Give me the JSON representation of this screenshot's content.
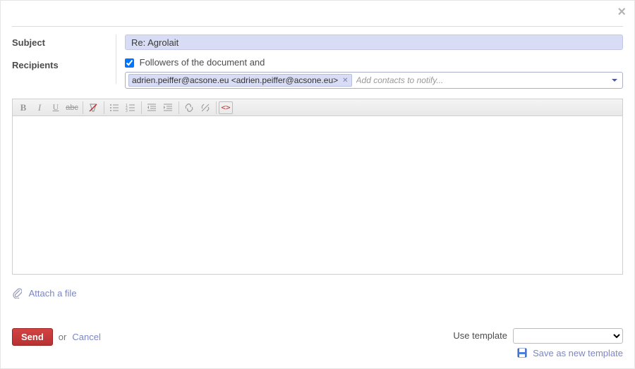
{
  "labels": {
    "subject": "Subject",
    "recipients": "Recipients"
  },
  "subject": "Re: Agrolait",
  "followers": {
    "checked": true,
    "label": "Followers of the document and"
  },
  "recipient_tag": "adrien.peiffer@acsone.eu <adrien.peiffer@acsone.eu>",
  "contacts_placeholder": "Add contacts to notify...",
  "toolbar": {
    "bold": "B",
    "italic": "I",
    "underline": "U",
    "strike": "abc",
    "src": "<>"
  },
  "attach": "Attach a file",
  "footer": {
    "send": "Send",
    "or": "or",
    "cancel": "Cancel",
    "use_template": "Use template",
    "save_template": "Save as new template"
  }
}
